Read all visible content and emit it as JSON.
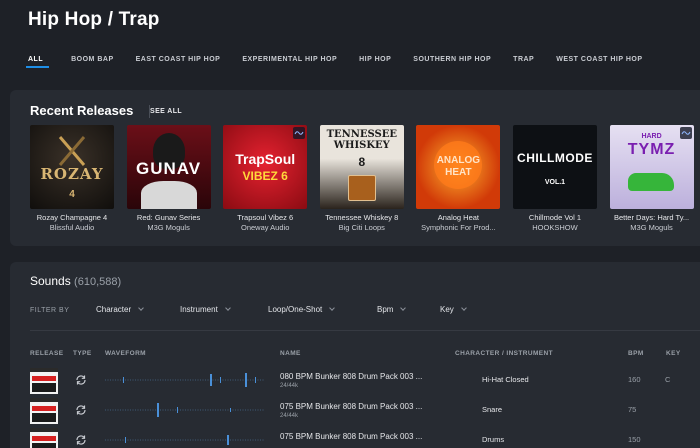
{
  "header": {
    "title": "Hip Hop / Trap"
  },
  "tabs": [
    {
      "label": "ALL",
      "active": true
    },
    {
      "label": "BOOM BAP"
    },
    {
      "label": "EAST COAST HIP HOP"
    },
    {
      "label": "EXPERIMENTAL HIP HOP"
    },
    {
      "label": "HIP HOP"
    },
    {
      "label": "SOUTHERN HIP HOP"
    },
    {
      "label": "TRAP"
    },
    {
      "label": "WEST COAST HIP HOP"
    }
  ],
  "recent": {
    "title": "Recent Releases",
    "see_all": "SEE ALL",
    "items": [
      {
        "title": "Rozay Champagne 4",
        "label": "Blissful Audio",
        "art_text": "ROZAY",
        "art_sub": "4",
        "bg": "#1a1714",
        "fg": "#d9b673"
      },
      {
        "title": "Red: Gunav Series",
        "label": "M3G Moguls",
        "art_text": "GUNAV",
        "art_sub": "",
        "bg": "#3a0c12",
        "fg": "#ffffff"
      },
      {
        "title": "Trapsoul Vibez 6",
        "label": "Oneway Audio",
        "art_text": "TrapSoul",
        "art_sub": "VIBEZ 6",
        "bg": "#b5121b",
        "fg": "#ffd93b"
      },
      {
        "title": "Tennessee Whiskey 8",
        "label": "Big Citi Loops",
        "art_text": "TENNESSEE WHISKEY",
        "art_sub": "8",
        "bg": "#1c1a18",
        "fg": "#ffffff"
      },
      {
        "title": "Analog Heat",
        "label": "Symphonic For Prod...",
        "art_text": "ANALOG HEAT",
        "art_sub": "",
        "bg": "#d94a12",
        "fg": "#ffe4c8"
      },
      {
        "title": "Chillmode Vol 1",
        "label": "HOOKSHOW",
        "art_text": "CHILLMODE",
        "art_sub": "VOL.1",
        "bg": "#0d1014",
        "fg": "#ffffff"
      },
      {
        "title": "Better Days: Hard Ty...",
        "label": "M3G Moguls",
        "art_text": "TYMZ",
        "art_sub": "HARD",
        "bg": "#cfc6e6",
        "fg": "#7a1fb0"
      }
    ]
  },
  "sounds": {
    "title": "Sounds",
    "count": "(610,588)",
    "filter_by": "FILTER BY",
    "filters": [
      "Character",
      "Instrument",
      "Loop/One-Shot",
      "Bpm",
      "Key"
    ],
    "columns": {
      "release": "RELEASE",
      "type": "TYPE",
      "waveform": "WAVEFORM",
      "name": "NAME",
      "character": "CHARACTER / INSTRUMENT",
      "bpm": "BPM",
      "key": "KEY"
    },
    "rows": [
      {
        "name": "080 BPM Bunker 808 Drum Pack 003 ...",
        "rate": "24/44k",
        "character": "Hi-Hat Closed",
        "bpm": "160",
        "key": "C"
      },
      {
        "name": "075 BPM Bunker 808 Drum Pack 003 ...",
        "rate": "24/44k",
        "character": "Snare",
        "bpm": "75",
        "key": ""
      },
      {
        "name": "075 BPM Bunker 808 Drum Pack 003 ...",
        "rate": "",
        "character": "Drums",
        "bpm": "150",
        "key": ""
      }
    ]
  },
  "colors": {
    "accent": "#1e8ee6",
    "bg": "#1e2127",
    "panel": "#272b32"
  }
}
